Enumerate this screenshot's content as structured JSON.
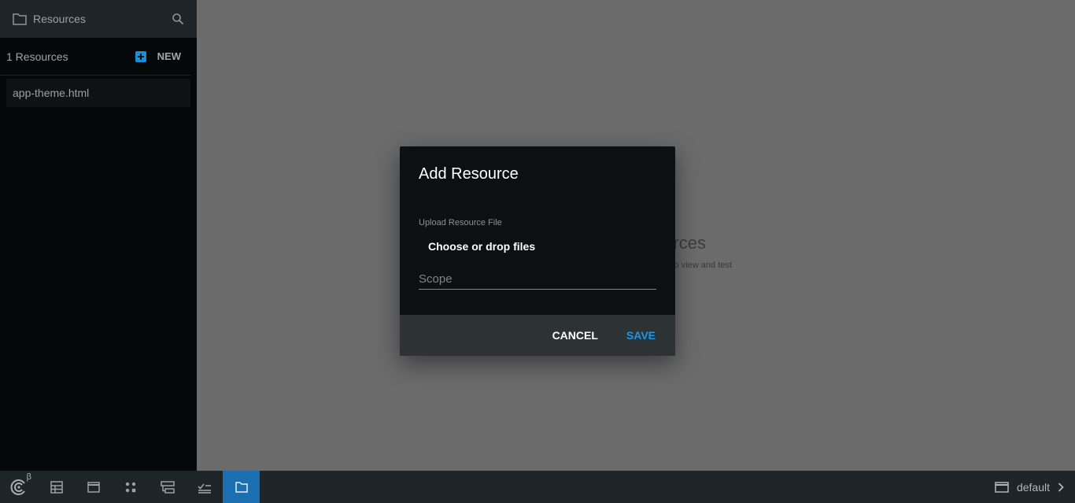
{
  "sidebar": {
    "header_title": "Resources",
    "count_label": "1 Resources",
    "new_label": "NEW",
    "items": [
      {
        "label": "app-theme.html"
      }
    ]
  },
  "background": {
    "title_fragment": "sources",
    "subtitle_fragment": "l to view and test"
  },
  "dialog": {
    "title": "Add Resource",
    "upload_label": "Upload Resource File",
    "choose_button": "Choose or drop files",
    "scope_placeholder": "Scope",
    "cancel_label": "CANCEL",
    "save_label": "SAVE"
  },
  "bottombar": {
    "logo_beta": "β",
    "environment_label": "default",
    "buttons": [
      "grid-icon",
      "window-icon",
      "apps-icon",
      "flow-icon",
      "checklist-icon",
      "folder-icon"
    ],
    "active_button": "folder-icon"
  },
  "colors": {
    "accent": "#1a99e6",
    "active_tab": "#1a6fb0",
    "sidebar_bg": "#050708",
    "dialog_bg": "#0d1013"
  }
}
